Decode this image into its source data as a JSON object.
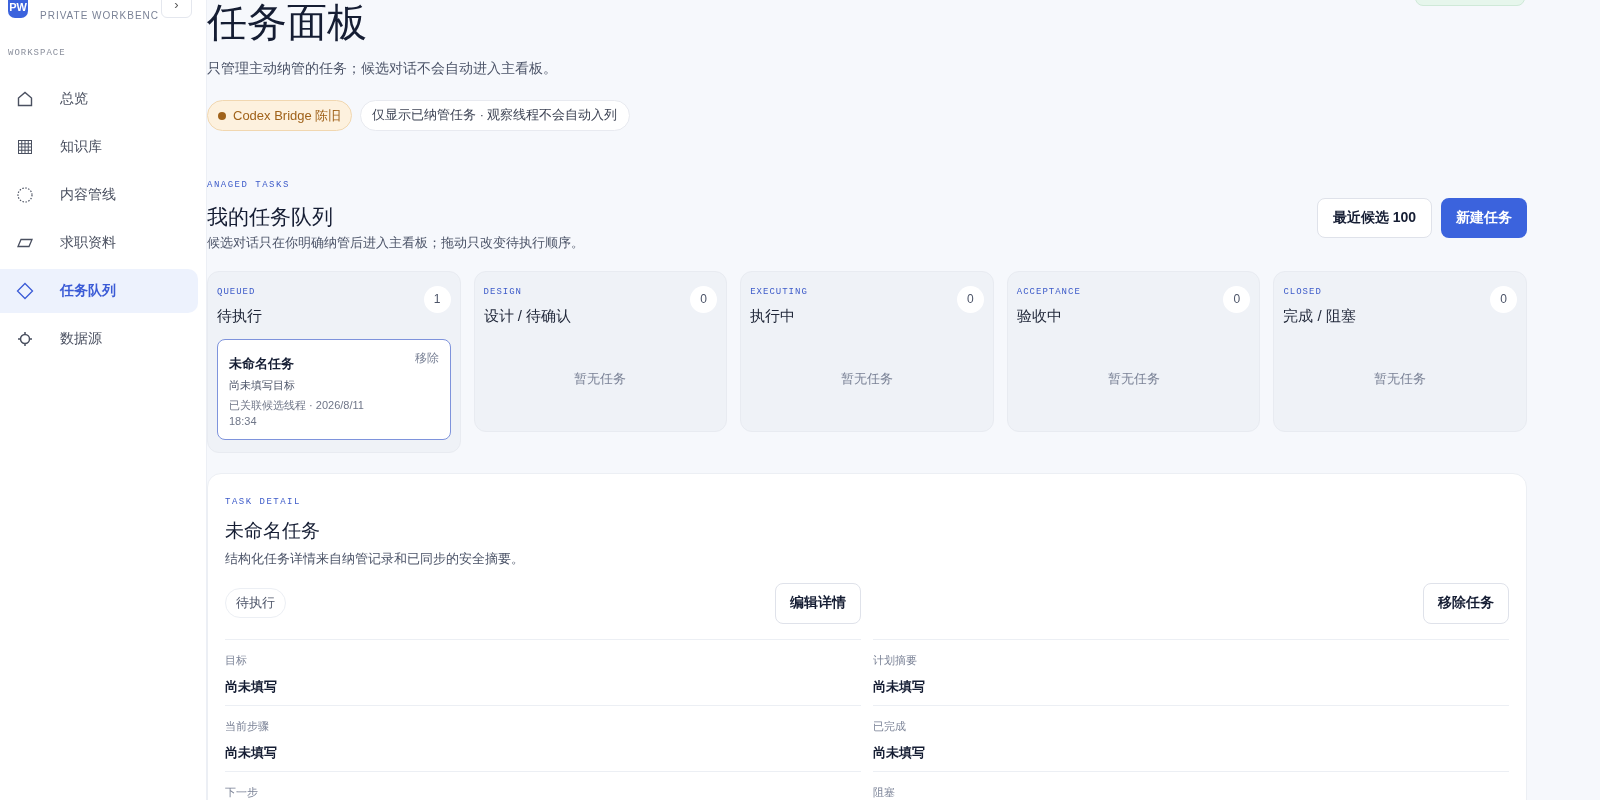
{
  "sidebar": {
    "logo": "PW",
    "subtitle": "PRIVATE WORKBENC",
    "toggle": "›",
    "section": "WORKSPACE",
    "items": [
      {
        "label": "总览",
        "selected": false
      },
      {
        "label": "知识库",
        "selected": false
      },
      {
        "label": "内容管线",
        "selected": false
      },
      {
        "label": "求职资料",
        "selected": false
      },
      {
        "label": "任务队列",
        "selected": true
      },
      {
        "label": "数据源",
        "selected": false
      }
    ]
  },
  "header": {
    "title": "任务面板",
    "subtitle": "只管理主动纳管的任务；候选对话不会自动进入主看板。",
    "pills": [
      {
        "kind": "status",
        "label": "Codex Bridge 陈旧",
        "color": "#a0621a"
      },
      {
        "kind": "plain",
        "label": "仅显示已纳管任务 · 观察线程不会自动入列"
      }
    ]
  },
  "queue": {
    "eyebrow": "ANAGED TASKS",
    "title": "我的任务队列",
    "subtitle": "候选对话只在你明确纳管后进入主看板；拖动只改变待执行顺序。",
    "buttons": [
      {
        "kind": "secondary",
        "label": "最近候选 100"
      },
      {
        "kind": "primary",
        "label": "新建任务"
      }
    ],
    "columns": [
      {
        "eyebrow": "QUEUED",
        "title": "待执行",
        "count": "1",
        "cards": [
          {
            "title": "未命名任务",
            "action": "移除",
            "goal": "尚未填写目标",
            "meta": "已关联候选线程 · 2026/8/11 18:34",
            "selected": true
          }
        ]
      },
      {
        "eyebrow": "DESIGN",
        "title": "设计 / 待确认",
        "count": "0",
        "empty": "暂无任务"
      },
      {
        "eyebrow": "EXECUTING",
        "title": "执行中",
        "count": "0",
        "empty": "暂无任务"
      },
      {
        "eyebrow": "ACCEPTANCE",
        "title": "验收中",
        "count": "0",
        "empty": "暂无任务"
      },
      {
        "eyebrow": "CLOSED",
        "title": "完成 / 阻塞",
        "count": "0",
        "empty": "暂无任务"
      }
    ]
  },
  "detail": {
    "eyebrow": "TASK DETAIL",
    "title": "未命名任务",
    "subtitle": "结构化任务详情来自纳管记录和已同步的安全摘要。",
    "status": "待执行",
    "buttons": [
      "编辑详情",
      "移除任务"
    ],
    "fields": [
      {
        "label": "目标",
        "value": "尚未填写"
      },
      {
        "label": "计划摘要",
        "value": "尚未填写"
      },
      {
        "label": "当前步骤",
        "value": "尚未填写"
      },
      {
        "label": "已完成",
        "value": "尚未填写"
      },
      {
        "label": "下一步"
      },
      {
        "label": "阻塞"
      }
    ]
  }
}
